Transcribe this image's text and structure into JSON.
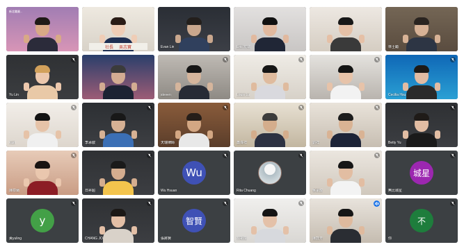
{
  "meeting": {
    "tiles": [
      {
        "name": "",
        "type": "video",
        "c1": "#a17db3",
        "c2": "#d895b6",
        "skin": "#d8a986",
        "hair": "#1f1a17",
        "shirt": "#2b2b3a",
        "muted": false,
        "corner_text": "新北職業..."
      },
      {
        "name": "",
        "type": "video",
        "c1": "#eee9e0",
        "c2": "#d8d2c8",
        "skin": "#efcdb6",
        "hair": "#2a1c16",
        "shirt": "#1f2f52",
        "muted": false,
        "sign": [
          "社長",
          "吳志寶"
        ]
      },
      {
        "name": "Evan Lin",
        "type": "video",
        "c1": "#2a2e35",
        "c2": "#3c3f46",
        "skin": "#c9a78d",
        "hair": "#231f1c",
        "shirt": "#30405d",
        "muted": false
      },
      {
        "name": "Eric 宏瑞",
        "type": "video",
        "c1": "#e2e0df",
        "c2": "#c9c6c4",
        "skin": "#e1b99f",
        "hair": "#111111",
        "shirt": "#202636",
        "muted": false
      },
      {
        "name": "",
        "type": "video",
        "c1": "#ede8e2",
        "c2": "#d5cdc2",
        "skin": "#e5c0a6",
        "hair": "#181818",
        "shirt": "#3a3a3a",
        "muted": false
      },
      {
        "name": "林士勵",
        "type": "video",
        "c1": "#746655",
        "c2": "#5a4c3f",
        "skin": "#d7b296",
        "hair": "#2a2420",
        "shirt": "#2d3544",
        "muted": false
      },
      {
        "name": "Yu Lin",
        "type": "video",
        "c1": "#2f3134",
        "c2": "#3b3d40",
        "skin": "#ecc8ad",
        "hair": "#d2a15b",
        "shirt": "#e9c9a7",
        "muted": true
      },
      {
        "name": "",
        "type": "video",
        "c1": "#2a3f6b",
        "c2": "#9d5c76",
        "skin": "#d3ac92",
        "hair": "#3b3b3b",
        "shirt": "#1c2233",
        "muted": false
      },
      {
        "name": "steven",
        "type": "video",
        "c1": "#bfbab4",
        "c2": "#8e8a84",
        "skin": "#d5b59c",
        "hair": "#161616",
        "shirt": "#272b35",
        "muted": true
      },
      {
        "name": "Louis Lu",
        "type": "video",
        "c1": "#efece6",
        "c2": "#d7d1c8",
        "skin": "#dfbb9e",
        "hair": "#161616",
        "shirt": "#d9d9de",
        "muted": true
      },
      {
        "name": "",
        "type": "video",
        "c1": "#e4e2de",
        "c2": "#b9b4ae",
        "skin": "#e7c3a9",
        "hair": "#141414",
        "shirt": "#f2f2f2",
        "muted": true
      },
      {
        "name": "Cecilia Hsu",
        "type": "video",
        "c1": "#0f67b6",
        "c2": "#2aa0d4",
        "skin": "#e1bba3",
        "hair": "#1d1a18",
        "shirt": "#2a2a2a",
        "muted": true
      },
      {
        "name": "Kurt",
        "type": "video",
        "c1": "#f2eee9",
        "c2": "#ddd6cd",
        "skin": "#e6c3a8",
        "hair": "#141414",
        "shirt": "#f0f0f0",
        "muted": true
      },
      {
        "name": "李承叡",
        "type": "video",
        "c1": "#2c2f33",
        "c2": "#3d3f43",
        "skin": "#d6b194",
        "hair": "#181818",
        "shirt": "#3b6fb5",
        "muted": true
      },
      {
        "name": "天瑞律師",
        "type": "video",
        "c1": "#8a5c3b",
        "c2": "#5a3d2a",
        "skin": "#d3a783",
        "hair": "#261e19",
        "shirt": "#e8e8e8",
        "muted": true
      },
      {
        "name": "蕭偉祥",
        "type": "video",
        "c1": "#e8e1d3",
        "c2": "#c2b6a0",
        "skin": "#d4ad8c",
        "hair": "#3c3c3c",
        "shirt": "#2d3242",
        "muted": true
      },
      {
        "name": "劉祥",
        "type": "video",
        "c1": "#e9e3da",
        "c2": "#c7beb2",
        "skin": "#d9b394",
        "hair": "#1c1c1c",
        "shirt": "#1d2438",
        "muted": true
      },
      {
        "name": "Betty Yu",
        "type": "video",
        "c1": "#2e3033",
        "c2": "#3c3e42",
        "skin": "#e2bda3",
        "hair": "#1f1b18",
        "shirt": "#1a1a1a",
        "muted": true
      },
      {
        "name": "陳樹蘭",
        "type": "video",
        "c1": "#e7cbb8",
        "c2": "#c99c84",
        "skin": "#eac7ae",
        "hair": "#1a1412",
        "shirt": "#8c1d25",
        "muted": true
      },
      {
        "name": "日昇超",
        "type": "video",
        "c1": "#2f3134",
        "c2": "#3c3e42",
        "skin": "#d4ad8f",
        "hair": "#1a1a1a",
        "shirt": "#f3c44d",
        "muted": true
      },
      {
        "name": "Wu Hsuan",
        "type": "avatar",
        "initial": "Wu",
        "color": "#3f51b5",
        "muted": true
      },
      {
        "name": "Rita Chuang",
        "type": "avatar-photo",
        "color": "#cfd8dc",
        "muted": true
      },
      {
        "name": "吳承龍",
        "type": "video",
        "c1": "#ebe6df",
        "c2": "#d0c8bd",
        "skin": "#e2bda2",
        "hair": "#161616",
        "shirt": "#f3f3f3",
        "muted": true
      },
      {
        "name": "無比城星",
        "type": "avatar",
        "initial": "城星",
        "color": "#9c27b0",
        "muted": true
      },
      {
        "name": "黃yuling",
        "type": "avatar",
        "initial": "y",
        "color": "#43a047",
        "muted": true
      },
      {
        "name": "CHANG JO",
        "type": "video",
        "c1": "#2f3134",
        "c2": "#3c3e42",
        "skin": "#e3bfa6",
        "hair": "#1b1816",
        "shirt": "#d9d2c9",
        "muted": true
      },
      {
        "name": "張將賢",
        "type": "avatar",
        "initial": "智賢",
        "color": "#3f51b5",
        "muted": true
      },
      {
        "name": "林裕傑",
        "type": "video",
        "c1": "#f0efed",
        "c2": "#d9d7d3",
        "skin": "#e4c1a8",
        "hair": "#141414",
        "shirt": "#d7d9dd",
        "muted": true
      },
      {
        "name": "陳鼓芳",
        "type": "video",
        "c1": "#e8e3dc",
        "c2": "#c5bcb0",
        "skin": "#dfba9e",
        "hair": "#161616",
        "shirt": "#2a2d33",
        "muted": false,
        "speaking": true
      },
      {
        "name": "你",
        "type": "avatar",
        "initial": "不",
        "color": "#1e7d3c",
        "muted": true
      }
    ]
  },
  "colors": {
    "tile_bg": "#3c4043",
    "speaking": "#1a73e8"
  },
  "icons": {
    "muted": "mic-off-icon",
    "speaking": "audio-level-icon"
  }
}
